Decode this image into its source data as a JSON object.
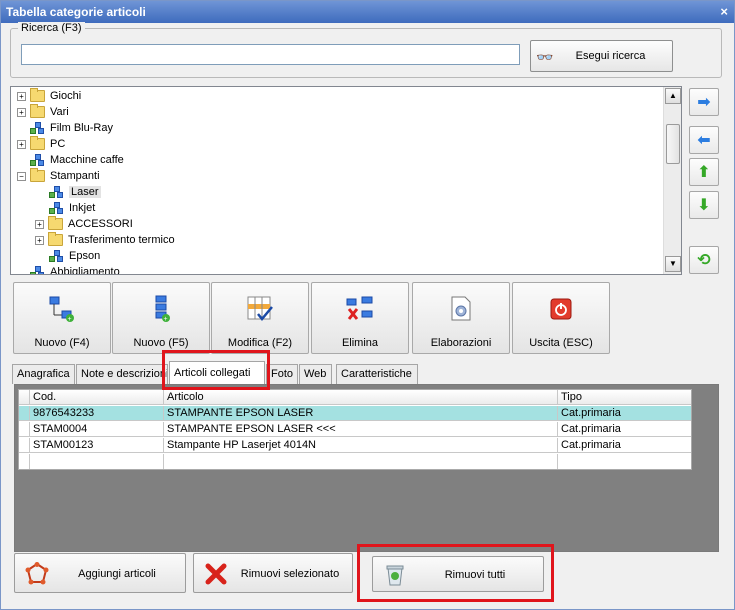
{
  "window": {
    "title": "Tabella categorie articoli",
    "close_glyph": "×"
  },
  "search": {
    "legend": "Ricerca (F3)",
    "value": "",
    "placeholder": "",
    "button_label": "Esegui ricerca",
    "button_icon": "binoculars-icon"
  },
  "tree": {
    "items": [
      {
        "label": "Giochi",
        "type": "folder",
        "expander": "+"
      },
      {
        "label": "Vari",
        "type": "folder",
        "expander": "+"
      },
      {
        "label": "Film Blu-Ray",
        "type": "leaf",
        "expander": ""
      },
      {
        "label": "PC",
        "type": "folder",
        "expander": "+"
      },
      {
        "label": "Macchine caffe",
        "type": "leaf",
        "expander": ""
      },
      {
        "label": "Stampanti",
        "type": "folder",
        "expander": "−"
      },
      {
        "label": "Laser",
        "type": "leaf",
        "expander": "",
        "selected": true
      },
      {
        "label": "Inkjet",
        "type": "leaf",
        "expander": ""
      },
      {
        "label": "ACCESSORI",
        "type": "folder",
        "expander": "+"
      },
      {
        "label": "Trasferimento termico",
        "type": "folder",
        "expander": "+"
      },
      {
        "label": "Epson",
        "type": "leaf",
        "expander": ""
      },
      {
        "label": "Abbigliamento",
        "type": "leaf",
        "expander": ""
      }
    ]
  },
  "side_buttons": [
    {
      "icon": "arrow-right-icon",
      "glyph": "➡"
    },
    {
      "icon": "arrow-left-icon",
      "glyph": "⬅"
    },
    {
      "icon": "arrow-up-icon",
      "glyph": "⬆"
    },
    {
      "icon": "arrow-down-icon",
      "glyph": "⬇"
    },
    {
      "icon": "refresh-icon",
      "glyph": "⟲"
    }
  ],
  "toolbar": {
    "nuovo_f4": "Nuovo (F4)",
    "nuovo_f5": "Nuovo (F5)",
    "modifica": "Modifica (F2)",
    "elimina": "Elimina",
    "elaborazioni": "Elaborazioni",
    "uscita": "Uscita (ESC)"
  },
  "tabs": [
    {
      "label": "Anagrafica"
    },
    {
      "label": "Note e descrizioni"
    },
    {
      "label": "Articoli collegati",
      "active": true
    },
    {
      "label": "Foto"
    },
    {
      "label": "Web"
    },
    {
      "label": "Caratteristiche"
    }
  ],
  "grid": {
    "columns": [
      "Cod.",
      "Articolo",
      "Tipo"
    ],
    "rows": [
      {
        "cod": "9876543233",
        "articolo": "STAMPANTE EPSON LASER",
        "tipo": "Cat.primaria",
        "selected": true
      },
      {
        "cod": "STAM0004",
        "articolo": "STAMPANTE EPSON LASER <<<",
        "tipo": "Cat.primaria"
      },
      {
        "cod": "STAM00123",
        "articolo": "Stampante HP Laserjet 4014N",
        "tipo": "Cat.primaria"
      }
    ]
  },
  "bottom": {
    "aggiungi": "Aggiungi articoli",
    "rimuovi_sel": "Rimuovi selezionato",
    "rimuovi_tutti": "Rimuovi tutti"
  },
  "colors": {
    "highlight": "#e0151c",
    "selected_row": "#a4e1e1",
    "title_bar": "#3e6bbd"
  }
}
